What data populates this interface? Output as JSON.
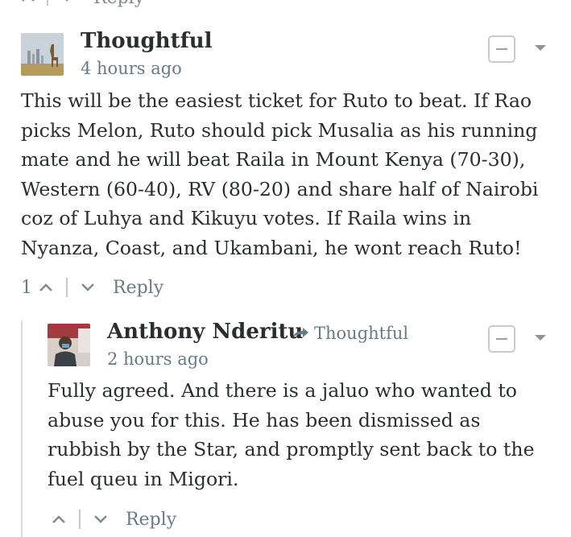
{
  "top_strip": {
    "reply_label": "Reply"
  },
  "comments": [
    {
      "author": "Thoughtful",
      "timestamp": "4 hours ago",
      "body_lines": [
        "This will be the easiest ticket for Ruto to beat. If Rao",
        "picks Melon, Ruto should pick Musalia as his running",
        "mate and he will beat Raila in Mount Kenya (70-30),",
        "Western (60-40), RV (80-20) and share half of Nairobi",
        "coz of Luhya and Kikuyu votes. If Raila wins in",
        "Nyanza, Coast, and Ukambani, he wont reach Ruto!"
      ],
      "upvotes": "1",
      "reply_label": "Reply",
      "avatar": "giraffe-skyline-avatar"
    },
    {
      "author": "Anthony Nderitu",
      "reply_to": "Thoughtful",
      "timestamp": "2 hours ago",
      "body_lines": [
        "Fully agreed. And there is a jaluo who wanted to",
        "abuse you for this. He has been dismissed as",
        "rubbish by the Star, and promptly sent back to the",
        "fuel queu in Migori."
      ],
      "reply_label": "Reply",
      "avatar": "person-photo-avatar"
    }
  ],
  "colors": {
    "text": "#2a2e2e",
    "meta": "#687a86",
    "divider": "#c4c9cb"
  }
}
